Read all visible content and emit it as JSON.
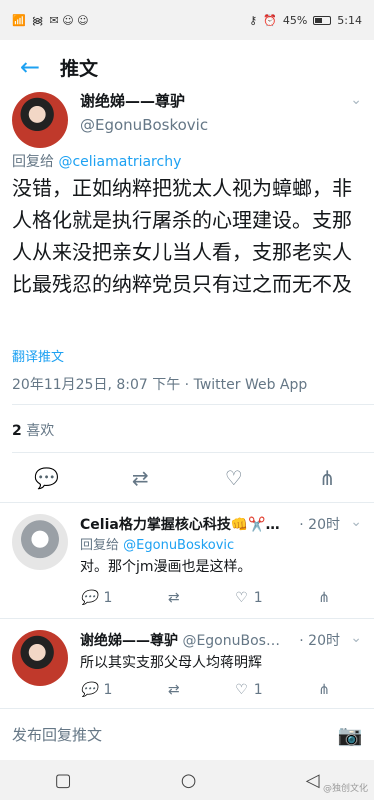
{
  "status_bar": {
    "battery": "45%",
    "time": "5:14"
  },
  "header": {
    "title": "推文"
  },
  "main_tweet": {
    "display_name": "谢绝娣——尊驴",
    "handle": "@EgonuBoskovic",
    "replying_prefix": "回复给",
    "replying_to": "@celiamatriarchy",
    "text": "没错，正如纳粹把犹太人视为蟑螂，非人格化就是执行屠杀的心理建设。支那人从来没把亲女儿当人看，支那老实人比最残忍的纳粹党员只有过之而无不及",
    "translate_label": "翻译推文",
    "meta": "20年11月25日, 8:07 下午 · Twitter Web App",
    "likes_count": "2",
    "likes_label": "喜欢"
  },
  "replies": [
    {
      "display_name": "Celia格力掌握核心科技👊✂️…",
      "handle": "",
      "time": "· 20时",
      "replying_prefix": "回复给",
      "replying_to": "@EgonuBoskovic",
      "text": "对。那个jm漫画也是这样。",
      "reply_count": "1",
      "retweet_count": "",
      "like_count": "1"
    },
    {
      "display_name": "谢绝娣——尊驴",
      "handle": "@EgonuBos…",
      "time": "· 20时",
      "replying_prefix": "",
      "replying_to": "",
      "text": "所以其实支那父母人均蒋明辉",
      "reply_count": "1",
      "retweet_count": "",
      "like_count": "1"
    }
  ],
  "compose": {
    "placeholder": "发布回复推文"
  },
  "watermark": "@独创文化"
}
